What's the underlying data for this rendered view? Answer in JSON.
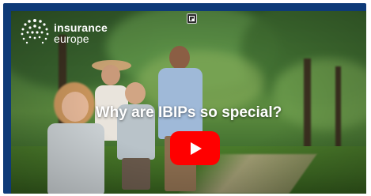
{
  "video": {
    "headline": "Why are IBIPs so special?",
    "play_button_label": "Play",
    "play_button_color": "#ff0000",
    "frame_color": "#0e3a78"
  },
  "logo": {
    "line1": "insurance",
    "line2": "europe"
  },
  "icons": {
    "play": "play-icon",
    "top": "picture-in-picture-icon",
    "logo_mark": "globe-dots-icon"
  }
}
